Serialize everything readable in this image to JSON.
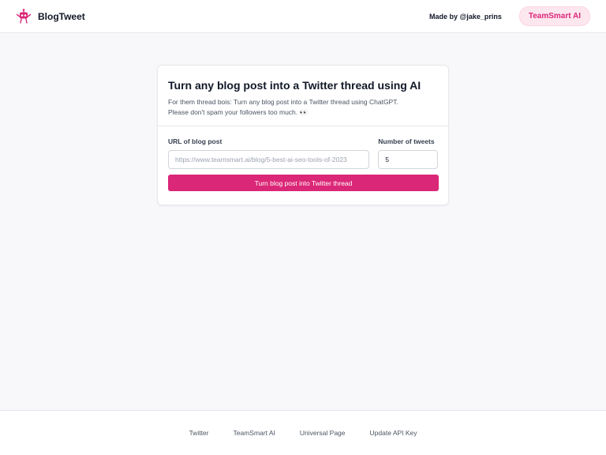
{
  "header": {
    "logo_text": "BlogTweet",
    "made_by": "Made by @jake_prins",
    "brand_button": "TeamSmart AI",
    "accent_color": "#db2777"
  },
  "card": {
    "title": "Turn any blog post into a Twitter thread using AI",
    "description_line1": "For them thread bois: Turn any blog post into a Twitter thread using ChatGPT.",
    "description_line2": "Please don't spam your followers too much. 👀",
    "url_label": "URL of blog post",
    "url_placeholder": "https://www.teamsmart.ai/blog/5-best-ai-seo-tools-of-2023",
    "tweets_label": "Number of tweets",
    "tweets_value": "5",
    "submit_label": "Turn blog post into Twitter thread"
  },
  "footer": {
    "links": [
      "Twitter",
      "TeamSmart AI",
      "Universal Page",
      "Update API Key"
    ]
  }
}
